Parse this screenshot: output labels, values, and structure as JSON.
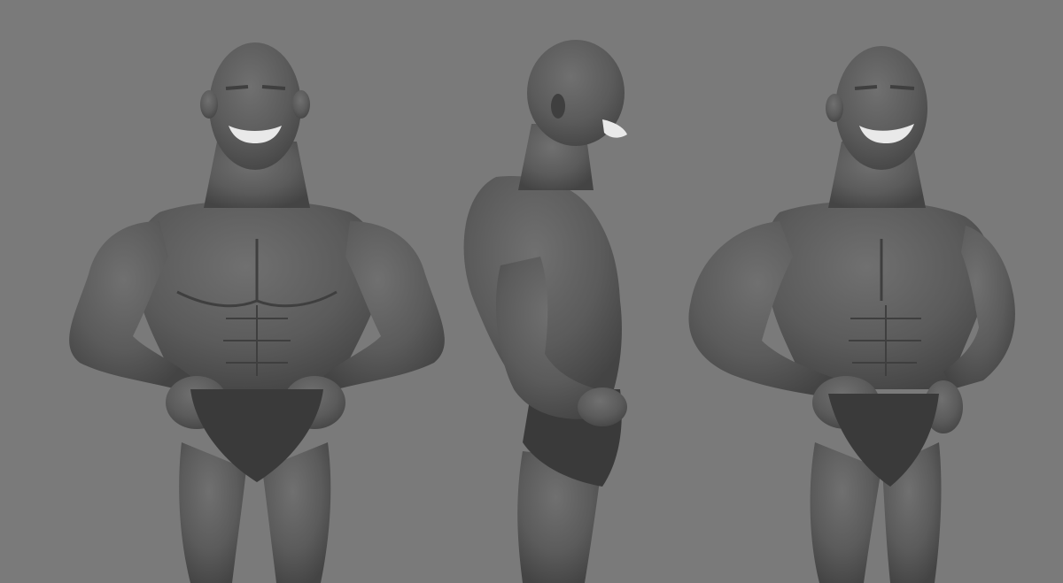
{
  "scene": {
    "background_color": "#7a7a7a",
    "model_color": "#5c5c5c",
    "shadow_color": "#3f3f3f",
    "briefs_color": "#3a3a3a",
    "teeth_color": "#e9e9e9",
    "views": [
      {
        "angle": "front"
      },
      {
        "angle": "side-profile"
      },
      {
        "angle": "three-quarter"
      }
    ]
  }
}
